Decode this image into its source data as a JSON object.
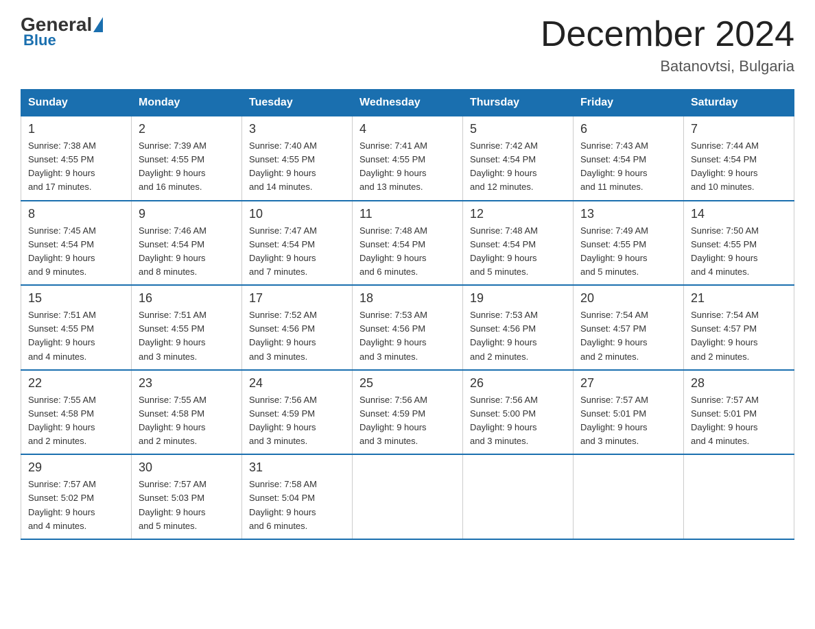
{
  "logo": {
    "general": "General",
    "blue": "Blue"
  },
  "header": {
    "title": "December 2024",
    "location": "Batanovtsi, Bulgaria"
  },
  "days_of_week": [
    "Sunday",
    "Monday",
    "Tuesday",
    "Wednesday",
    "Thursday",
    "Friday",
    "Saturday"
  ],
  "weeks": [
    [
      {
        "day": "1",
        "sunrise": "7:38 AM",
        "sunset": "4:55 PM",
        "daylight": "9 hours and 17 minutes."
      },
      {
        "day": "2",
        "sunrise": "7:39 AM",
        "sunset": "4:55 PM",
        "daylight": "9 hours and 16 minutes."
      },
      {
        "day": "3",
        "sunrise": "7:40 AM",
        "sunset": "4:55 PM",
        "daylight": "9 hours and 14 minutes."
      },
      {
        "day": "4",
        "sunrise": "7:41 AM",
        "sunset": "4:55 PM",
        "daylight": "9 hours and 13 minutes."
      },
      {
        "day": "5",
        "sunrise": "7:42 AM",
        "sunset": "4:54 PM",
        "daylight": "9 hours and 12 minutes."
      },
      {
        "day": "6",
        "sunrise": "7:43 AM",
        "sunset": "4:54 PM",
        "daylight": "9 hours and 11 minutes."
      },
      {
        "day": "7",
        "sunrise": "7:44 AM",
        "sunset": "4:54 PM",
        "daylight": "9 hours and 10 minutes."
      }
    ],
    [
      {
        "day": "8",
        "sunrise": "7:45 AM",
        "sunset": "4:54 PM",
        "daylight": "9 hours and 9 minutes."
      },
      {
        "day": "9",
        "sunrise": "7:46 AM",
        "sunset": "4:54 PM",
        "daylight": "9 hours and 8 minutes."
      },
      {
        "day": "10",
        "sunrise": "7:47 AM",
        "sunset": "4:54 PM",
        "daylight": "9 hours and 7 minutes."
      },
      {
        "day": "11",
        "sunrise": "7:48 AM",
        "sunset": "4:54 PM",
        "daylight": "9 hours and 6 minutes."
      },
      {
        "day": "12",
        "sunrise": "7:48 AM",
        "sunset": "4:54 PM",
        "daylight": "9 hours and 5 minutes."
      },
      {
        "day": "13",
        "sunrise": "7:49 AM",
        "sunset": "4:55 PM",
        "daylight": "9 hours and 5 minutes."
      },
      {
        "day": "14",
        "sunrise": "7:50 AM",
        "sunset": "4:55 PM",
        "daylight": "9 hours and 4 minutes."
      }
    ],
    [
      {
        "day": "15",
        "sunrise": "7:51 AM",
        "sunset": "4:55 PM",
        "daylight": "9 hours and 4 minutes."
      },
      {
        "day": "16",
        "sunrise": "7:51 AM",
        "sunset": "4:55 PM",
        "daylight": "9 hours and 3 minutes."
      },
      {
        "day": "17",
        "sunrise": "7:52 AM",
        "sunset": "4:56 PM",
        "daylight": "9 hours and 3 minutes."
      },
      {
        "day": "18",
        "sunrise": "7:53 AM",
        "sunset": "4:56 PM",
        "daylight": "9 hours and 3 minutes."
      },
      {
        "day": "19",
        "sunrise": "7:53 AM",
        "sunset": "4:56 PM",
        "daylight": "9 hours and 2 minutes."
      },
      {
        "day": "20",
        "sunrise": "7:54 AM",
        "sunset": "4:57 PM",
        "daylight": "9 hours and 2 minutes."
      },
      {
        "day": "21",
        "sunrise": "7:54 AM",
        "sunset": "4:57 PM",
        "daylight": "9 hours and 2 minutes."
      }
    ],
    [
      {
        "day": "22",
        "sunrise": "7:55 AM",
        "sunset": "4:58 PM",
        "daylight": "9 hours and 2 minutes."
      },
      {
        "day": "23",
        "sunrise": "7:55 AM",
        "sunset": "4:58 PM",
        "daylight": "9 hours and 2 minutes."
      },
      {
        "day": "24",
        "sunrise": "7:56 AM",
        "sunset": "4:59 PM",
        "daylight": "9 hours and 3 minutes."
      },
      {
        "day": "25",
        "sunrise": "7:56 AM",
        "sunset": "4:59 PM",
        "daylight": "9 hours and 3 minutes."
      },
      {
        "day": "26",
        "sunrise": "7:56 AM",
        "sunset": "5:00 PM",
        "daylight": "9 hours and 3 minutes."
      },
      {
        "day": "27",
        "sunrise": "7:57 AM",
        "sunset": "5:01 PM",
        "daylight": "9 hours and 3 minutes."
      },
      {
        "day": "28",
        "sunrise": "7:57 AM",
        "sunset": "5:01 PM",
        "daylight": "9 hours and 4 minutes."
      }
    ],
    [
      {
        "day": "29",
        "sunrise": "7:57 AM",
        "sunset": "5:02 PM",
        "daylight": "9 hours and 4 minutes."
      },
      {
        "day": "30",
        "sunrise": "7:57 AM",
        "sunset": "5:03 PM",
        "daylight": "9 hours and 5 minutes."
      },
      {
        "day": "31",
        "sunrise": "7:58 AM",
        "sunset": "5:04 PM",
        "daylight": "9 hours and 6 minutes."
      },
      null,
      null,
      null,
      null
    ]
  ],
  "sunrise_label": "Sunrise:",
  "sunset_label": "Sunset:",
  "daylight_label": "Daylight:"
}
